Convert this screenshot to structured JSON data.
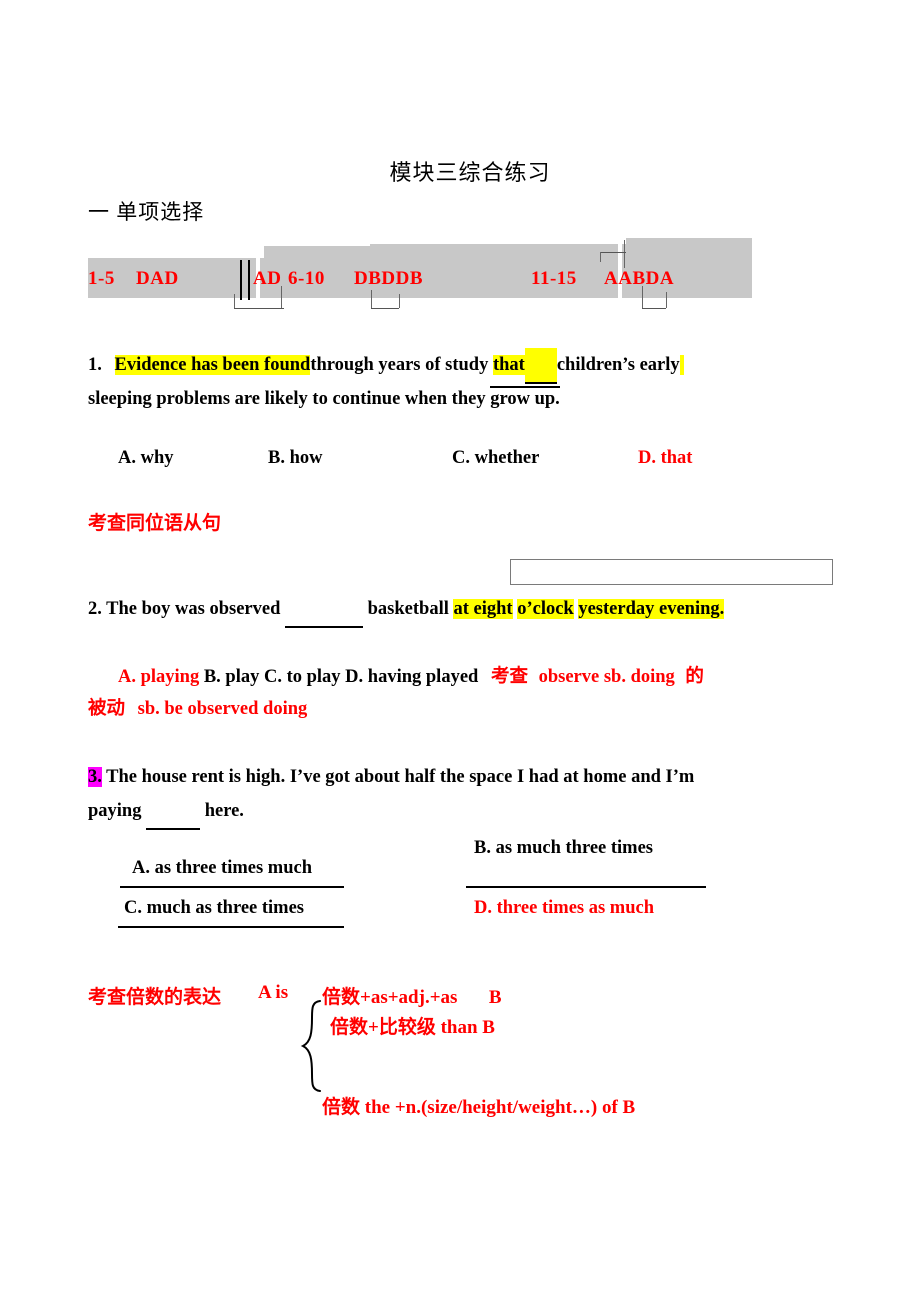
{
  "document": {
    "title": "模块三综合练习",
    "section_heading": "一  单项选择"
  },
  "answer_key": {
    "groups": [
      {
        "range": "1-5",
        "answers": "DAD",
        "answers_tail": "AD"
      },
      {
        "range": "6-10",
        "answers": "DBDDB"
      },
      {
        "range": "11-15",
        "answers": "AABDA"
      }
    ]
  },
  "questions": [
    {
      "number": "1.",
      "stem_part1": "Evidence has been found",
      "stem_part2": "through years of study ",
      "stem_that": "that",
      "stem_blank": "___",
      "stem_part3": "children’s early",
      "stem_line2_pre": "sleeping problems are likely to continue when they ",
      "stem_line2_overline": "grow up.",
      "options": [
        {
          "label": "A. why",
          "color": "black"
        },
        {
          "label": "B. how",
          "color": "black"
        },
        {
          "label": "C. whether",
          "color": "black"
        },
        {
          "label": "D. that",
          "color": "red"
        }
      ],
      "note": "考查同位语从句"
    },
    {
      "number": "2.",
      "stem_pre": "2. The boy was observed ",
      "stem_blank": "________",
      "stem_mid": " basketball ",
      "stem_hl1": "at eight",
      "stem_hl2": "o’clock",
      "stem_hl3": "yesterday evening.",
      "options_red": "A. playing",
      "options_black": "B. play C. to play D. having played",
      "note_line1_cn": "考查",
      "note_line1_en": "observe sb. doing",
      "note_line1_cn2": "的",
      "note_line2_cn": "被动",
      "note_line2_en": "sb. be observed doing"
    },
    {
      "number": "3.",
      "stem_line1": "The house rent is high. I’ve got about half the space I had at home and I’m",
      "stem_line2_pre": "paying ",
      "stem_line2_blank": "______",
      "stem_line2_post": " here.",
      "options": [
        {
          "label": "A. as three times much",
          "color": "black"
        },
        {
          "label": "B. as much three times",
          "color": "black"
        },
        {
          "label": "C. much as three times",
          "color": "black"
        },
        {
          "label": "D. three times as much",
          "color": "red"
        }
      ]
    }
  ],
  "formula_note": {
    "lead_cn": "考查倍数的表达",
    "lead_a_is": "A is",
    "line1": "倍数+as+adj.+as",
    "line1_b": "B",
    "line2": "倍数+比较级  than B",
    "line3": "倍数  the +n.(size/height/weight…) of B"
  },
  "colors": {
    "red": "#ff0000",
    "black": "#000000",
    "highlight_yellow": "#ffff00",
    "highlight_magenta": "#ff00ff",
    "shade_gray": "#c8c8c8",
    "box_border": "#7a7a7a"
  }
}
